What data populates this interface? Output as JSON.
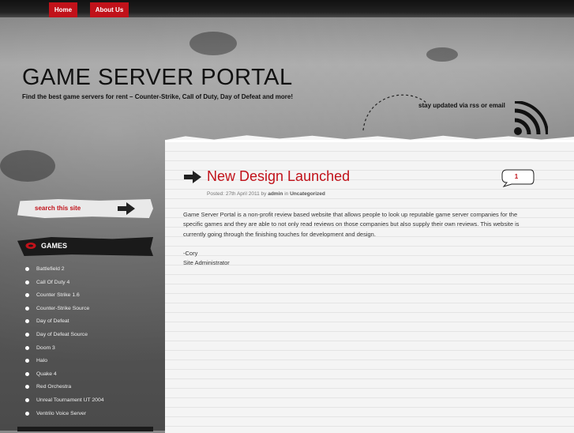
{
  "nav": {
    "items": [
      {
        "label": "Home"
      },
      {
        "label": "About Us"
      }
    ]
  },
  "header": {
    "title": "GAME SERVER PORTAL",
    "tagline": "Find the best game servers for rent – Counter-Strike, Call of Duty, Day of Defeat and more!",
    "rss_text": "stay updated via rss or email"
  },
  "search": {
    "label": "search this site"
  },
  "games": {
    "title": "GAMES",
    "items": [
      "Battlefield 2",
      "Call Of Duty 4",
      "Counter Strike 1.6",
      "Counter-Strike Source",
      "Day of Defeat",
      "Day of Defeat Source",
      "Doom 3",
      "Halo",
      "Quake 4",
      "Red Orchestra",
      "Unreal Tournament UT 2004",
      "Ventrilo Voice Server"
    ]
  },
  "post": {
    "title": "New Design Launched",
    "meta_prefix": "Posted: 27th April 2011 by",
    "author": "admin",
    "meta_in": "in",
    "category": "Uncategorized",
    "comment_count": "1",
    "body": [
      "Game Server Portal is a non-profit review based website that allows people to look up reputable game server companies for the specific games and they are able to not only read reviews on those companies but also supply their own reviews. This website is currently going through the finishing touches for development and design.",
      "-Cory",
      "Site Administrator"
    ]
  },
  "colors": {
    "accent": "#c1121a",
    "dark": "#1a1a1a"
  }
}
